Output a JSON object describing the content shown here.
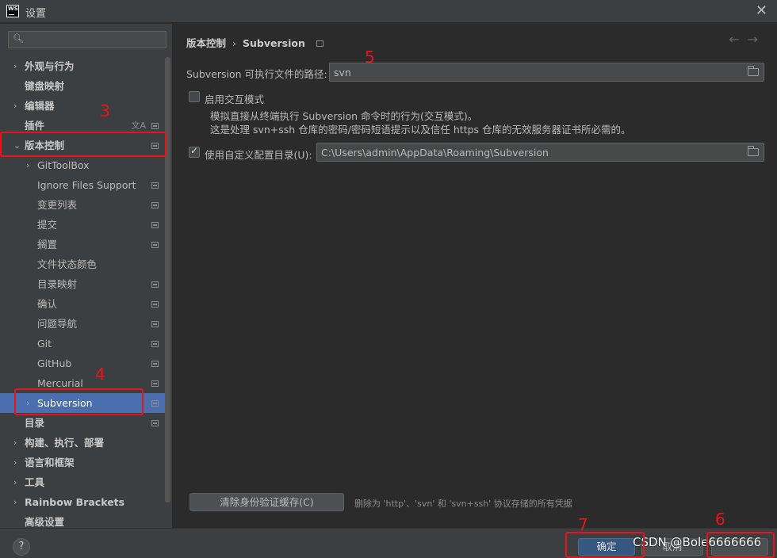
{
  "window": {
    "title": "设置",
    "app_icon_text": "WS",
    "close_glyph": "✕"
  },
  "sidebar": {
    "search_placeholder": "",
    "items": [
      {
        "label": "外观与行为",
        "bold": true,
        "chevron": "›"
      },
      {
        "label": "键盘映射",
        "bold": true
      },
      {
        "label": "编辑器",
        "bold": true,
        "chevron": "›"
      },
      {
        "label": "插件",
        "bold": true,
        "lang_glyph": "文A"
      },
      {
        "label": "版本控制",
        "bold": true,
        "chevron": "⌄"
      },
      {
        "label": "GitToolBox",
        "chevron": "›"
      },
      {
        "label": "Ignore Files Support"
      },
      {
        "label": "变更列表"
      },
      {
        "label": "提交"
      },
      {
        "label": "搁置"
      },
      {
        "label": "文件状态颜色"
      },
      {
        "label": "目录映射"
      },
      {
        "label": "确认"
      },
      {
        "label": "问题导航"
      },
      {
        "label": "Git"
      },
      {
        "label": "GitHub"
      },
      {
        "label": "Mercurial"
      },
      {
        "label": "Subversion",
        "chevron": "›",
        "selected": true
      },
      {
        "label": "目录",
        "bold": true
      },
      {
        "label": "构建、执行、部署",
        "bold": true,
        "chevron": "›"
      },
      {
        "label": "语言和框架",
        "bold": true,
        "chevron": "›"
      },
      {
        "label": "工具",
        "bold": true,
        "chevron": "›"
      },
      {
        "label": "Rainbow Brackets",
        "bold": true,
        "chevron": "›"
      },
      {
        "label": "高级设置",
        "bold": true
      }
    ]
  },
  "main": {
    "breadcrumb": {
      "parent": "版本控制",
      "separator": "›",
      "current": "Subversion"
    },
    "nav_back": "←",
    "nav_forward": "→",
    "executable_label": "Subversion 可执行文件的路径:",
    "executable_value": "svn",
    "interactive_label": "启用交互模式",
    "interactive_desc_1": "模拟直接从终端执行 Subversion 命令时的行为(交互模式)。",
    "interactive_desc_2": "这是处理 svn+ssh 仓库的密码/密码短语提示以及信任 https 仓库的无效服务器证书所必需的。",
    "custom_config_label": "使用自定义配置目录(U):",
    "custom_config_value": "C:\\Users\\admin\\AppData\\Roaming\\Subversion",
    "clear_cache_button": "清除身份验证缓存(C)",
    "clear_cache_hint": "删除为 'http'、'svn' 和 'svn+ssh' 协议存储的所有凭据"
  },
  "footer": {
    "help": "?",
    "ok_button": "确定",
    "cancel_button": "取消",
    "apply_button": ""
  },
  "watermark": "CSDN @Bole6666666",
  "annotations": {
    "n3": "3",
    "n4": "4",
    "n5": "5",
    "n6": "6",
    "n7": "7"
  },
  "colors": {
    "accent": "#4b6eaf",
    "annotation": "#e8141a",
    "ok_button": "#365880"
  }
}
